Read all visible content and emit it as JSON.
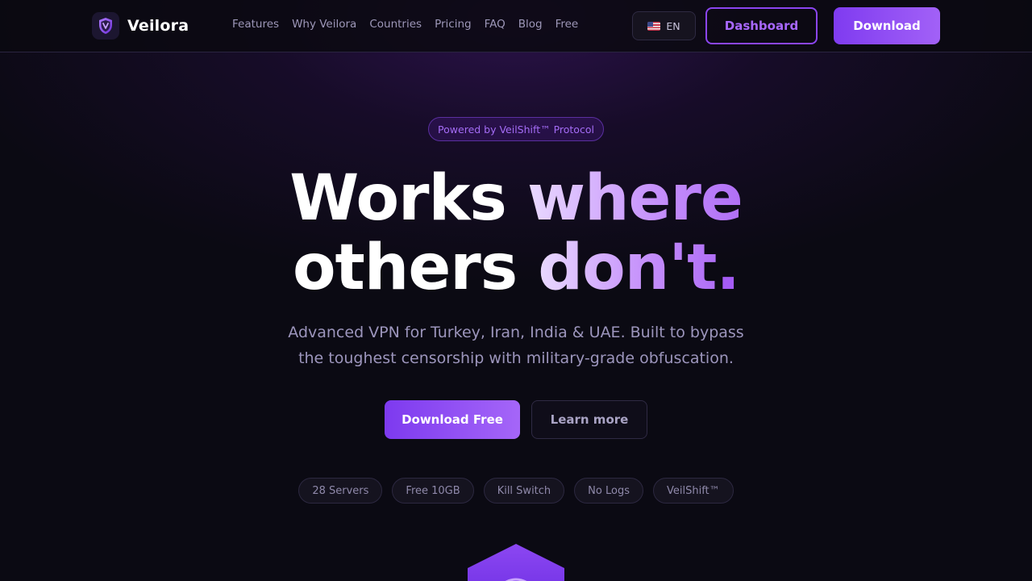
{
  "brand": {
    "name": "Veilora",
    "logo_icon": "shield-icon"
  },
  "nav": {
    "links": [
      "Features",
      "Why Veilora",
      "Countries",
      "Pricing",
      "FAQ",
      "Blog",
      "Free"
    ],
    "language": {
      "flag_icon": "us-flag-icon",
      "code": "EN"
    },
    "dashboard_label": "Dashboard",
    "download_label": "Download"
  },
  "hero": {
    "badge": "Powered by VeilShift™ Protocol",
    "headline": {
      "line1_a": "Works",
      "line1_b": "where",
      "line2_a": "others",
      "line2_b": "don't",
      "line2_dot": "."
    },
    "subtitle": "Advanced VPN for Turkey, Iran, India & UAE. Built to bypass the toughest censorship with military-grade obfuscation.",
    "primary_cta": "Download Free",
    "secondary_cta": "Learn more",
    "pills": [
      "28 Servers",
      "Free 10GB",
      "Kill Switch",
      "No Logs",
      "VeilShift™"
    ]
  },
  "colors": {
    "background": "#0b0a13",
    "accent": "#8b45f0",
    "accent_light": "#a566f8",
    "muted_text": "#9c95bc"
  }
}
